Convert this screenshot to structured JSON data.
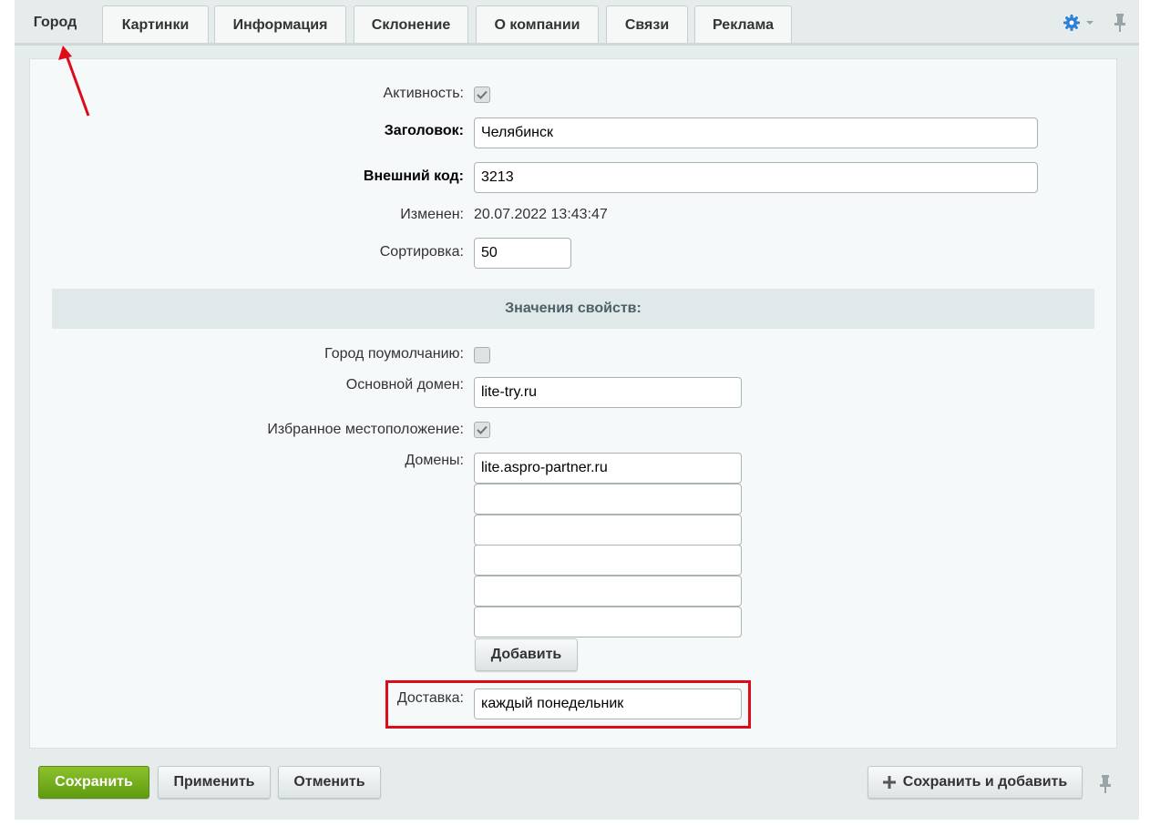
{
  "tabs": [
    {
      "label": "Город",
      "active": true
    },
    {
      "label": "Картинки"
    },
    {
      "label": "Информация"
    },
    {
      "label": "Склонение"
    },
    {
      "label": "О компании"
    },
    {
      "label": "Связи"
    },
    {
      "label": "Реклама"
    }
  ],
  "form": {
    "active_label": "Активность:",
    "active_checked": true,
    "title_label": "Заголовок:",
    "title_value": "Челябинск",
    "ext_code_label": "Внешний код:",
    "ext_code_value": "3213",
    "modified_label": "Изменен:",
    "modified_value": "20.07.2022 13:43:47",
    "sort_label": "Сортировка:",
    "sort_value": "50"
  },
  "properties": {
    "header": "Значения свойств:",
    "default_city_label": "Город поумолчанию:",
    "default_city_checked": false,
    "main_domain_label": "Основной домен:",
    "main_domain_value": "lite-try.ru",
    "favorite_location_label": "Избранное местоположение:",
    "favorite_location_checked": true,
    "domains_label": "Домены:",
    "domains": [
      "lite.aspro-partner.ru",
      "",
      "",
      "",
      "",
      ""
    ],
    "add_button": "Добавить",
    "delivery_label": "Доставка:",
    "delivery_value": "каждый понедельник"
  },
  "footer": {
    "save": "Сохранить",
    "apply": "Применить",
    "cancel": "Отменить",
    "save_and_add": "Сохранить и добавить"
  },
  "icons": {
    "gear": "gear-icon",
    "pin": "pin-icon",
    "plus": "plus-icon",
    "check": "check-icon"
  },
  "colors": {
    "accent_green": "#6fa81a",
    "highlight_red": "#e00b19",
    "gear_blue": "#2b7fd6"
  }
}
